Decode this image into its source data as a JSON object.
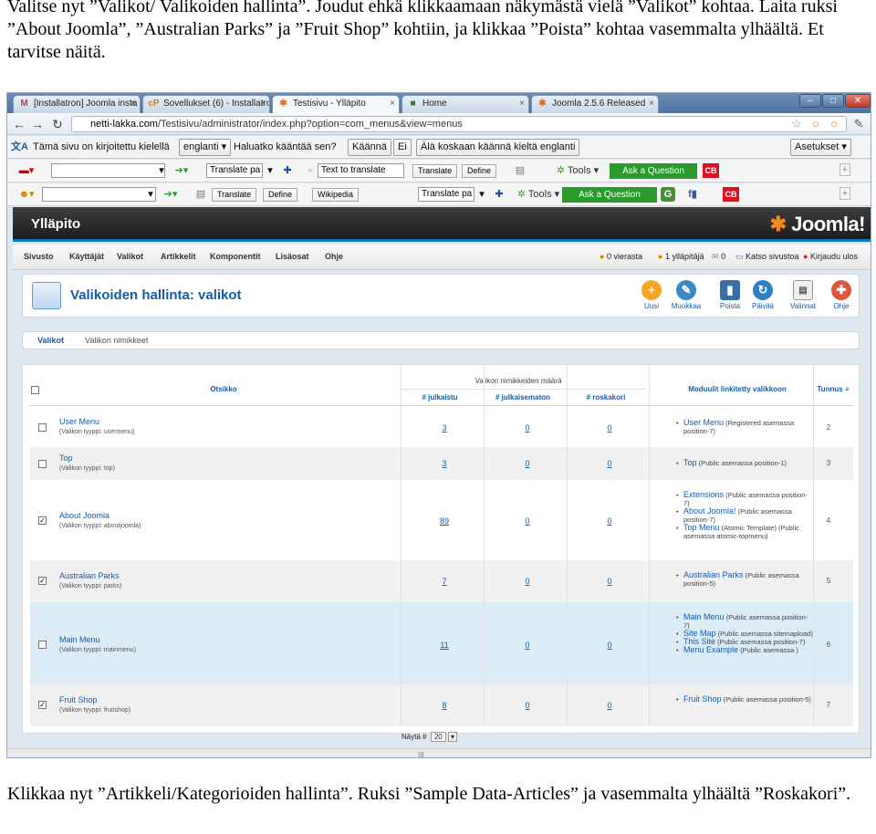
{
  "doc": {
    "top_text": "Valitse nyt ”Valikot/ Valikoiden hallinta”. Joudut ehkä klikkaamaan näkymästä vielä ”Valikot” kohtaa. Laita ruksi ”About Joomla”, ”Australian Parks” ja ”Fruit Shop” kohtiin, ja klikkaa ”Poista” kohtaa vasemmalta ylhäältä. Et tarvitse näitä.",
    "bottom_text": "Klikkaa nyt ”Artikkeli/Kategorioiden hallinta”. Ruksi ”Sample Data-Articles” ja vasemmalta ylhäältä ”Roskakori”."
  },
  "browser": {
    "tabs": [
      "[Installatron] Joomla insta",
      "Sovellukset (6) - Installatro",
      "Testisivu - Ylläpito",
      "Home",
      "Joomla 2.5.6 Released"
    ],
    "url_host": "netti-lakka.com",
    "url_path": "/Testisivu/administrator/index.php?option=com_menus&view=menus"
  },
  "translate_bar": {
    "message": "Tämä sivu on kirjoitettu kielellä",
    "language": "englanti",
    "question": "Haluatko kääntää sen?",
    "translate_button": "Käännä",
    "no_button": "Ei",
    "never_button": "Älä koskaan käännä kieltä englanti",
    "settings_button": "Asetukset"
  },
  "toolbar1": {
    "translate_select": "Translate pa",
    "text_input": "Text to translate",
    "translate_btn": "Translate",
    "define_btn": "Define",
    "tools": "Tools",
    "ask": "Ask a Question",
    "cb": "CB"
  },
  "toolbar2": {
    "translate_btn": "Translate",
    "define_btn": "Define",
    "wiki_btn": "Wikipedia",
    "translate_select": "Translate pa",
    "tools": "Tools",
    "ask": "Ask a Question",
    "cb": "CB"
  },
  "joomla": {
    "site_name": "Ylläpito",
    "logo_text": "Joomla!",
    "menu": [
      "Sivusto",
      "Käyttäjät",
      "Valikot",
      "Artikkelit",
      "Komponentit",
      "Lisäosat",
      "Ohje"
    ],
    "status": [
      "0 vierasta",
      "1 ylläpitäjä",
      "0",
      "Katso sivustoa",
      "Kirjaudu ulos"
    ],
    "page_title": "Valikoiden hallinta: valikot",
    "tools": [
      "Uusi",
      "Muokkaa",
      "Poista",
      "Päivitä",
      "Valinnat",
      "Ohje"
    ],
    "subtabs": [
      "Valikot",
      "Valikon nimikkeet"
    ],
    "headers": {
      "title": "Otsikko",
      "count_group": "Valikon nimikkeiden määrä",
      "published": "# julkaistu",
      "unpublished": "# julkaisematon",
      "trashed": "# roskakori",
      "modules": "Moduulit linkitetty valikkoon",
      "id": "Tunnus"
    },
    "rows": [
      {
        "title": "User Menu",
        "type": "(Valikon tyyppi: usermenu)",
        "checked": false,
        "pub": "3",
        "unpub": "0",
        "trash": "0",
        "id": "2",
        "mods": [
          {
            "name": "User Menu",
            "desc": "(Registered asemassa position-7)"
          }
        ]
      },
      {
        "title": "Top",
        "type": "(Valikon tyyppi: top)",
        "checked": false,
        "pub": "3",
        "unpub": "0",
        "trash": "0",
        "id": "3",
        "mods": [
          {
            "name": "Top",
            "desc": "(Public asemassa position-1)"
          }
        ]
      },
      {
        "title": "About Joomla",
        "type": "(Valikon tyyppi: aboutjoomla)",
        "checked": true,
        "pub": "89",
        "unpub": "0",
        "trash": "0",
        "id": "4",
        "mods": [
          {
            "name": "Extensions",
            "desc": "(Public asemassa position-7)"
          },
          {
            "name": "About Joomla!",
            "desc": "(Public asemassa position-7)"
          },
          {
            "name": "Top Menu",
            "desc": "(Atomic Template) (Public asemassa atomic-topmenu)"
          }
        ]
      },
      {
        "title": "Australian Parks",
        "type": "(Valikon tyyppi: parks)",
        "checked": true,
        "pub": "7",
        "unpub": "0",
        "trash": "0",
        "id": "5",
        "mods": [
          {
            "name": "Australian Parks",
            "desc": "(Public asemassa position-5)"
          }
        ]
      },
      {
        "title": "Main Menu",
        "type": "(Valikon tyyppi: mainmenu)",
        "checked": false,
        "pub": "11",
        "unpub": "0",
        "trash": "0",
        "id": "6",
        "mods": [
          {
            "name": "Main Menu",
            "desc": "(Public asemassa position-7)"
          },
          {
            "name": "Site Map",
            "desc": "(Public asemassa sitemapload)"
          },
          {
            "name": "This Site",
            "desc": "(Public asemassa position-7)"
          },
          {
            "name": "Menu Example",
            "desc": "(Public asemassa )"
          }
        ]
      },
      {
        "title": "Fruit Shop",
        "type": "(Valikon tyyppi: fruitshop)",
        "checked": true,
        "pub": "8",
        "unpub": "0",
        "trash": "0",
        "id": "7",
        "mods": [
          {
            "name": "Fruit Shop",
            "desc": "(Public asemassa position-5)"
          }
        ]
      }
    ],
    "pager_label": "Näytä #",
    "pager_value": "20"
  }
}
